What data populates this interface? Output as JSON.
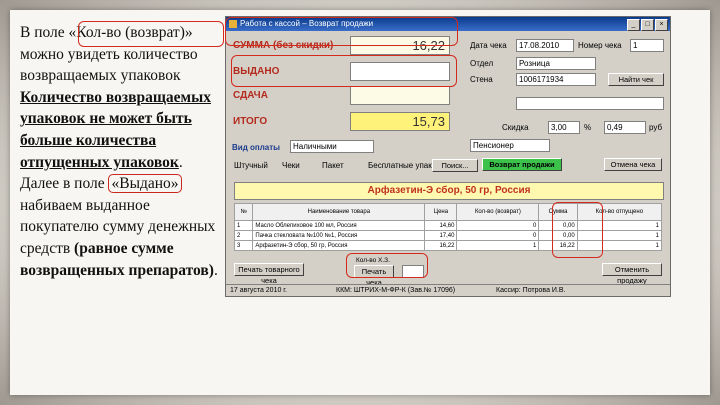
{
  "instruction": {
    "p1": "В поле «Кол-во (возврат)» можно увидеть количество возвращаемых упаковок",
    "p2": "Количество возвращаемых упаковок не может быть больше количества отпущенных упаковок",
    "p3a": ". Далее в поле ",
    "p3b": "«Выдано»",
    "p3c": " набиваем выданное покупателю сумму денежных средств",
    "p4": "(равное сумме возвращенных препаратов)",
    "p5": "."
  },
  "window": {
    "title": "Работа с кассой – Возврат продажи"
  },
  "totals": {
    "sum_label": "СУММА (без скидки)",
    "sum_value": "16,22",
    "issued_label": "ВЫДАНО",
    "issued_value": "",
    "change_label": "СДАЧА",
    "change_value": "",
    "total_label": "ИТОГО",
    "total_value": "15,73"
  },
  "check": {
    "date_label": "Дата чека",
    "date_value": "17.08.2010",
    "number_label": "Номер чека",
    "number_value": "1",
    "dept_label": "Отдел",
    "dept_value": "Розница",
    "line_label": "Стена",
    "line_value": "1006171934",
    "find_button": "Найти чек",
    "discount_label": "Скидка",
    "discount_value": "3,00",
    "percent": "%",
    "discount_sum": "0,49",
    "currency": "руб",
    "customer_value": "Пенсионер"
  },
  "payment": {
    "label": "Вид оплаты",
    "value": "Наличными"
  },
  "toolbar": {
    "piece": "Штучный",
    "receipt": "Чеки",
    "recipe": "Пакет",
    "free": "Бесплатные упаковки",
    "search": "Поиск...",
    "return_button": "Возврат продажи",
    "cancel_button": "Отмена чека"
  },
  "product_name": "Арфазетин-Э сбор, 50 гр, Россия",
  "table": {
    "headers": [
      "№",
      "Наименование товара",
      "Цена",
      "Кол-во (возврат)",
      "Сумма",
      "Кол-во отпущено"
    ],
    "rows": [
      [
        "1",
        "Масло Облепиховое 100 мл, Россия",
        "14,60",
        "0",
        "0,00",
        "1"
      ],
      [
        "2",
        "Пачка стекловата №100 №1, Россия",
        "17,40",
        "0",
        "0,00",
        "1"
      ],
      [
        "3",
        "Арфазетин-Э сбор, 50 гр, Россия",
        "16,22",
        "1",
        "16,22",
        "1"
      ]
    ]
  },
  "bottom": {
    "print_button": "Печать товарного чека",
    "qty_label": "Кол-во Х.З.",
    "print_check": "Печать чека",
    "cancel_sale": "Отменить продажу"
  },
  "status": {
    "date": "17 августа 2010 г.",
    "kkm": "ККМ: ШТРИХ-М-ФР-К (Зав.№ 17096)",
    "cashier": "Кассир: Потрова И.В."
  }
}
